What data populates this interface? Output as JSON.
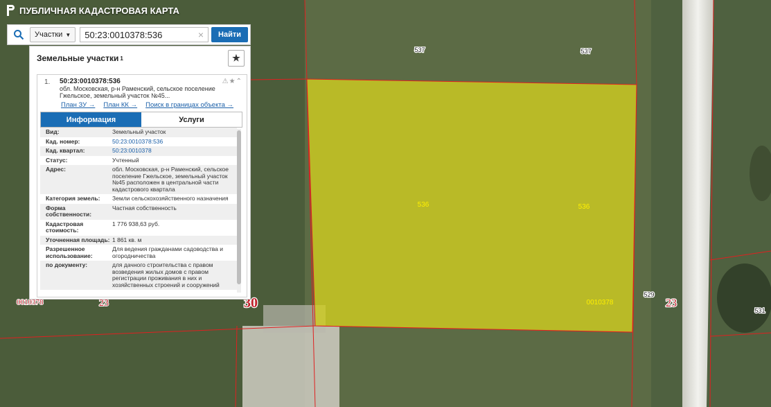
{
  "header": {
    "title": "ПУБЛИЧНАЯ КАДАСТРОВАЯ КАРТА"
  },
  "search": {
    "type_label": "Участки",
    "query": "50:23:0010378:536",
    "find_label": "Найти"
  },
  "panel": {
    "title": "Земельные участки",
    "count": "1",
    "result": {
      "index": "1.",
      "number": "50:23:0010378:536",
      "address_short": "обл. Московская, р-н Раменский, сельское поселение Гжельское, земельный участок №45...",
      "links": [
        "План ЗУ →",
        "План КК →",
        "Поиск в границах объекта →"
      ]
    },
    "tabs": [
      "Информация",
      "Услуги"
    ],
    "rows": [
      {
        "k": "Вид:",
        "v": "Земельный участок"
      },
      {
        "k": "Кад. номер:",
        "v": "50:23:0010378:536",
        "link": true
      },
      {
        "k": "Кад. квартал:",
        "v": "50:23:0010378",
        "link": true
      },
      {
        "k": "Статус:",
        "v": "Учтенный"
      },
      {
        "k": "Адрес:",
        "v": "обл. Московская, р-н Раменский, сельское поселение Гжельское, земельный участок №45 расположен в центральной части кадастрового квартала"
      },
      {
        "k": "Категория земель:",
        "v": "Земли сельскохозяйственного назначения"
      },
      {
        "k": "Форма собственности:",
        "v": "Частная собственность"
      },
      {
        "k": "Кадастровая стоимость:",
        "v": "1 776 938,63 руб."
      },
      {
        "k": "Уточненная площадь:",
        "v": "1 861 кв. м"
      },
      {
        "k": "Разрешенное использование:",
        "v": "Для ведения гражданами садоводства и огородничества"
      },
      {
        "k": "по документу:",
        "v": "для дачного строительства с правом возведения жилых домов с правом регистрации проживания в них и хозяйственных строений и сооружений"
      }
    ]
  },
  "map_labels": {
    "white": [
      "537",
      "537",
      "529",
      "531"
    ],
    "yellow": [
      "536",
      "536",
      "0010378"
    ],
    "red": [
      "23",
      "30",
      "0010378",
      "23"
    ]
  },
  "colors": {
    "accent": "#1a6db5",
    "parcel_fill": "#d4d11f",
    "boundary": "#e02020"
  }
}
